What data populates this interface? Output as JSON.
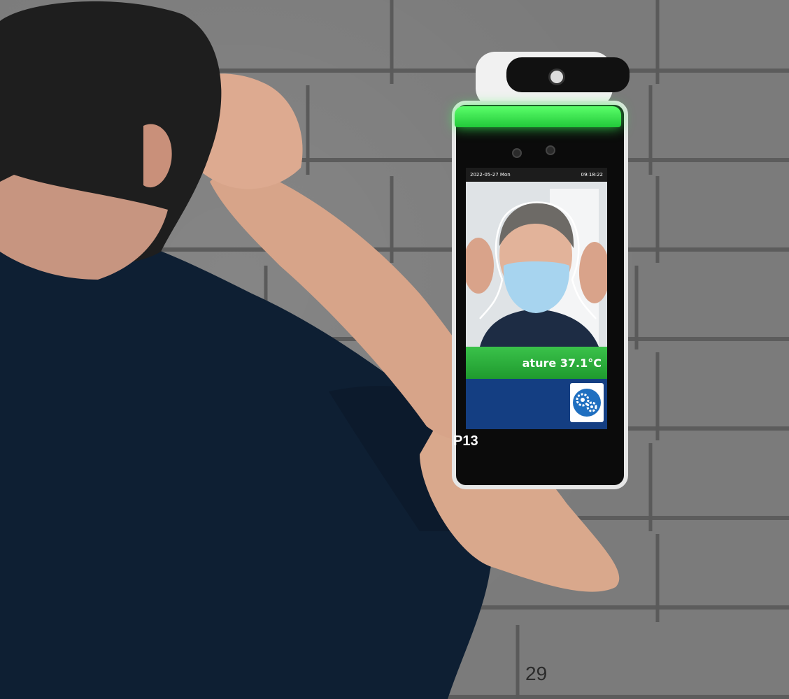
{
  "device": {
    "label": "P13",
    "screen": {
      "date": "2022-05-27 Mon",
      "time": "09:18:22",
      "temperature_text": "ature 37.1°C",
      "settings_icon": "gear-icon"
    },
    "lightbar_color": "#2ee64a"
  },
  "page": {
    "number": "29"
  }
}
